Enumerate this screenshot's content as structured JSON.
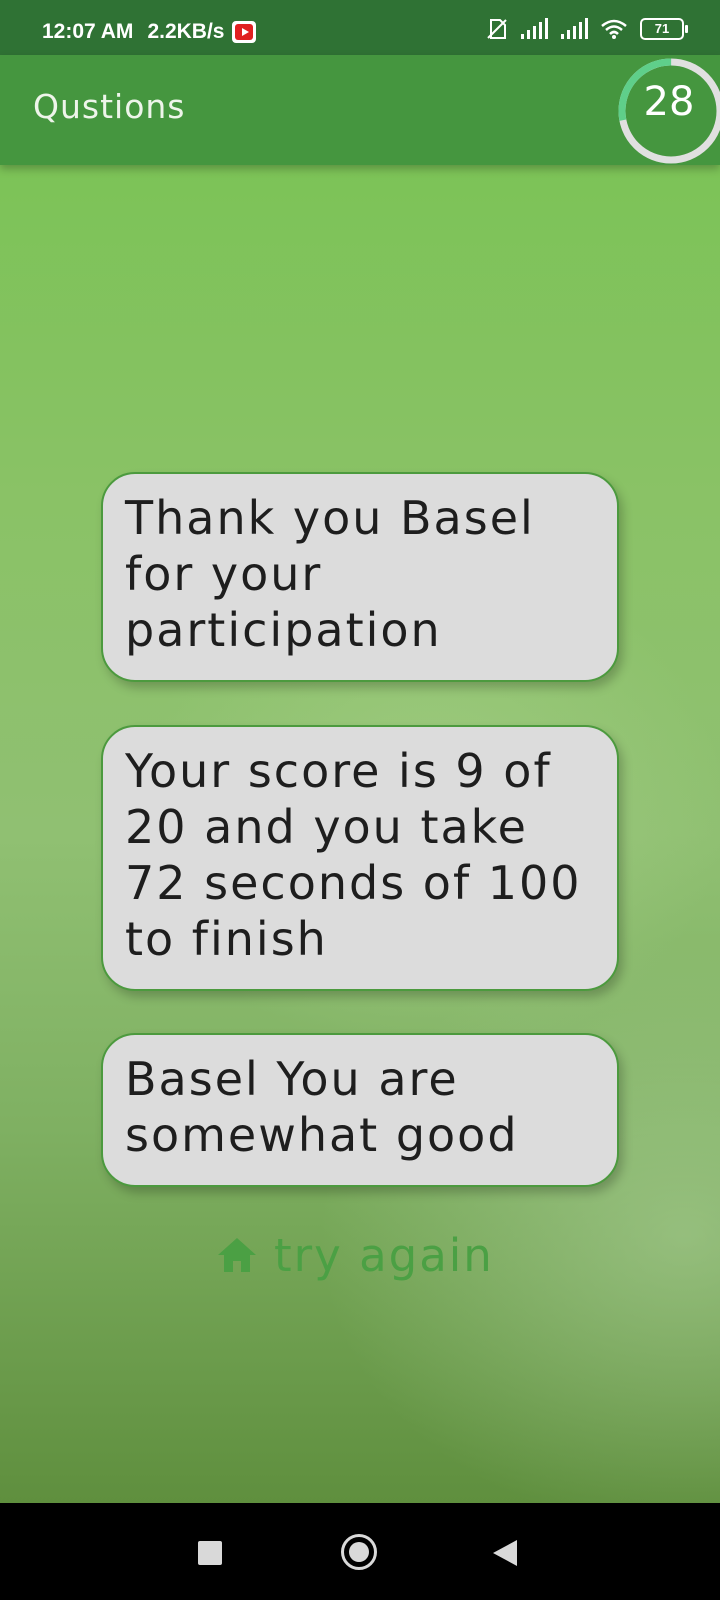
{
  "status_bar": {
    "time": "12:07 AM",
    "speed": "2.2KB/s",
    "notification_icon": "youtube-icon",
    "battery": "71"
  },
  "app_bar": {
    "title": "Qustions",
    "timer_value": "28",
    "timer_progress": 0.28
  },
  "results": {
    "thanks": "Thank you Basel for your participation",
    "score": "Your score is 9 of 20 and you take 72 seconds of 100 to finish",
    "rating": "Basel You are somewhat good"
  },
  "actions": {
    "try_again_label": "try again",
    "try_again_icon": "home-icon"
  },
  "colors": {
    "app_bar": "#45963f",
    "status_bar": "#2f7234",
    "accent_green": "#4ba044",
    "card_bg": "#dcdcdc",
    "timer_ring": "#5fcf8a"
  },
  "nav_bar": {
    "icons": [
      "recents-square-icon",
      "home-circle-icon",
      "back-triangle-icon"
    ]
  }
}
